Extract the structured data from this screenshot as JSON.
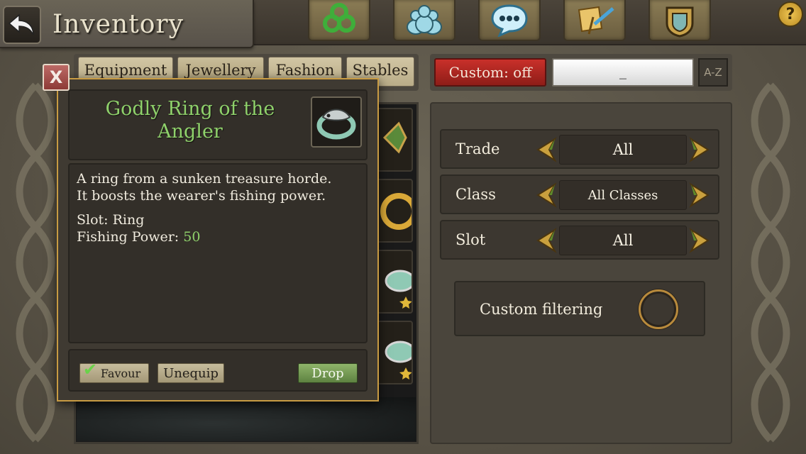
{
  "header": {
    "title": "Inventory",
    "back_icon": "back-arrow-icon",
    "help_label": "?",
    "nav": [
      {
        "name": "triskele-icon"
      },
      {
        "name": "friends-icon"
      },
      {
        "name": "chat-icon"
      },
      {
        "name": "quest-scroll-icon"
      },
      {
        "name": "guild-crest-icon"
      }
    ]
  },
  "tabs": [
    "Equipment",
    "Jewellery",
    "Fashion",
    "Stables"
  ],
  "search": {
    "custom_label": "Custom: off",
    "value": "_",
    "sort_label": "A-Z"
  },
  "filters": [
    {
      "label": "Trade",
      "value": "All"
    },
    {
      "label": "Class",
      "value": "All Classes"
    },
    {
      "label": "Slot",
      "value": "All"
    }
  ],
  "custom_filtering": {
    "label": "Custom filtering"
  },
  "popup": {
    "close_label": "X",
    "item_name": "Godly Ring of the Angler",
    "description_line1": "A ring from a sunken treasure horde.",
    "description_line2": "It boosts the wearer's fishing power.",
    "slot_line": "Slot: Ring",
    "fishing_label": "Fishing Power: ",
    "fishing_value": "50",
    "buttons": {
      "favour": "Favour",
      "unequip": "Unequip",
      "drop": "Drop"
    }
  },
  "colors": {
    "item_name": "#8fd16b",
    "custom_off": "#c9302a",
    "popup_border": "#c89b43"
  }
}
